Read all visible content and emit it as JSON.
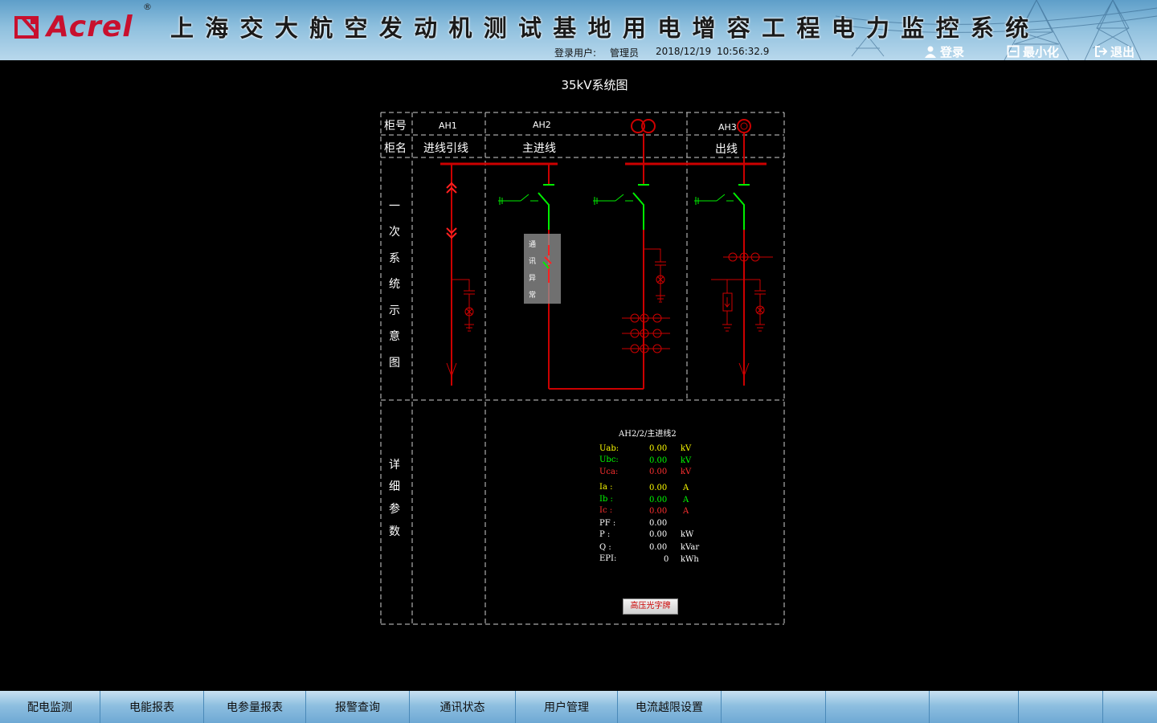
{
  "header": {
    "logo_text": "Acrel",
    "logo_reg": "®",
    "title": "上海交大航空发动机测试基地用电增容工程电力监控系统",
    "user_label": "登录用户:",
    "user_name": "管理员",
    "date": "2018/12/19",
    "time": "10:56:32.9",
    "login_label": "登录",
    "minimize_label": "最小化",
    "exit_label": "退出"
  },
  "diagram": {
    "title": "35kV系统图",
    "row_no_label": "柜号",
    "row_name_label": "柜名",
    "primary_label_chars": [
      "一",
      "次",
      "系",
      "统",
      "示",
      "意",
      "图"
    ],
    "detail_label_chars": [
      "详",
      "细",
      "参",
      "数"
    ],
    "cabinets": [
      {
        "no": "AH1",
        "name": "进线引线"
      },
      {
        "no": "AH2",
        "name": "主进线"
      },
      {
        "no": "AH3",
        "name": "出线"
      }
    ],
    "comm_fault_chars": [
      "通",
      "讯",
      "异",
      "常"
    ]
  },
  "params": {
    "title": "AH2/2/主进线2",
    "rows": [
      {
        "name": "Uab:",
        "value": "0.00",
        "unit": "kV"
      },
      {
        "name": "Ubc:",
        "value": "0.00",
        "unit": "kV"
      },
      {
        "name": "Uca:",
        "value": "0.00",
        "unit": "kV"
      },
      {
        "name": "Ia :",
        "value": "0.00",
        "unit": "A"
      },
      {
        "name": "Ib :",
        "value": "0.00",
        "unit": "A"
      },
      {
        "name": "Ic :",
        "value": "0.00",
        "unit": "A"
      },
      {
        "name": "PF :",
        "value": "0.00",
        "unit": ""
      },
      {
        "name": "P  :",
        "value": "0.00",
        "unit": "kW"
      },
      {
        "name": "Q  :",
        "value": "0.00",
        "unit": "kVar"
      },
      {
        "name": "EPI:",
        "value": "0",
        "unit": "kWh"
      }
    ],
    "button_label": "高压光字牌"
  },
  "colors": {
    "phase_a": "#ffff00",
    "phase_b": "#00ff00",
    "phase_c": "#ff0000",
    "bus": "#cc0000",
    "switch_open": "#00ee00"
  },
  "footer": {
    "tabs": [
      "配电监测",
      "电能报表",
      "电参量报表",
      "报警查询",
      "通讯状态",
      "用户管理",
      "电流越限设置",
      "",
      "",
      "",
      "",
      ""
    ]
  }
}
